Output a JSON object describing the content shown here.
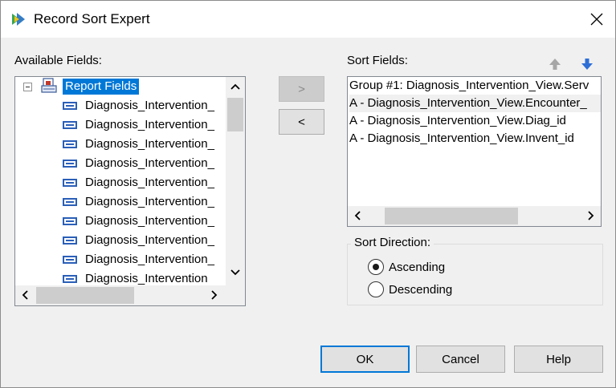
{
  "window": {
    "title": "Record Sort Expert"
  },
  "available": {
    "label": "Available Fields:",
    "root_label": "Report Fields",
    "fields": [
      "Diagnosis_Intervention_",
      "Diagnosis_Intervention_",
      "Diagnosis_Intervention_",
      "Diagnosis_Intervention_",
      "Diagnosis_Intervention_",
      "Diagnosis_Intervention_",
      "Diagnosis_Intervention_",
      "Diagnosis_Intervention_",
      "Diagnosis_Intervention_",
      "Diagnosis_Intervention"
    ]
  },
  "move": {
    "add_label": ">",
    "remove_label": "<"
  },
  "sort": {
    "label": "Sort Fields:",
    "items": [
      "Group #1: Diagnosis_Intervention_View.Serv",
      "A - Diagnosis_Intervention_View.Encounter_",
      "A - Diagnosis_Intervention_View.Diag_id",
      "A - Diagnosis_Intervention_View.Invent_id"
    ],
    "direction": {
      "legend": "Sort Direction:",
      "ascending_label": "Ascending",
      "descending_label": "Descending",
      "selected": "Ascending"
    }
  },
  "buttons": {
    "ok": "OK",
    "cancel": "Cancel",
    "help": "Help"
  },
  "colors": {
    "selection": "#0078d7",
    "field_icon": "#2a5fb8"
  },
  "icons": {
    "app": "crystal-reports-icon",
    "close": "close-icon",
    "move_up": "arrow-up-icon",
    "move_down": "arrow-down-icon"
  }
}
